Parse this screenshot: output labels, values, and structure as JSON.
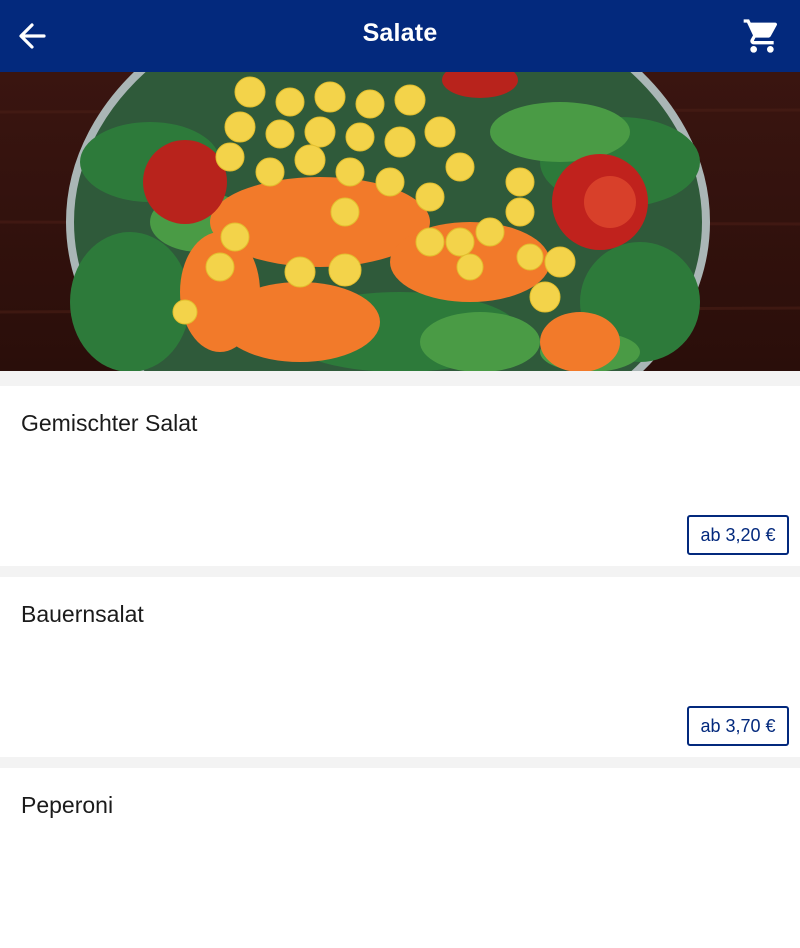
{
  "header": {
    "title": "Salate",
    "back_icon": "arrow-left-icon",
    "cart_icon": "shopping-cart-icon",
    "background": "#03297d"
  },
  "hero": {
    "image": "salad-bowl-photo"
  },
  "items": [
    {
      "name": "Gemischter Salat",
      "price": "ab 3,20 €"
    },
    {
      "name": "Bauernsalat",
      "price": "ab 3,70 €"
    },
    {
      "name": "Peperoni",
      "price": ""
    }
  ],
  "colors": {
    "accent": "#03297d",
    "card": "#ffffff",
    "page": "#f3f3f3"
  }
}
